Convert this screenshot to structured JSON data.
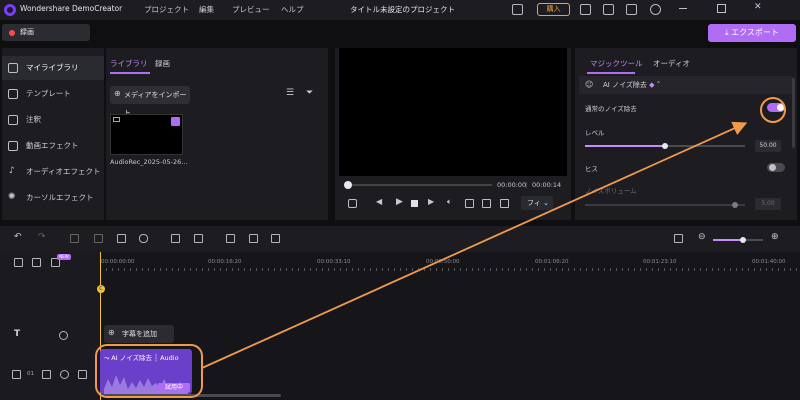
{
  "titlebar": {
    "app_name": "Wondershare DemoCreator",
    "menu": [
      "プロジェクト",
      "編集",
      "プレビュー",
      "ヘルプ"
    ],
    "project_title": "タイトル未設定のプロジェクト",
    "buy_label": "購入"
  },
  "toolbar": {
    "record_label": "録画",
    "export_label": "エクスポート"
  },
  "sidebar": {
    "items": [
      {
        "label": "マイライブラリ",
        "icon": "layers-icon"
      },
      {
        "label": "テンプレート",
        "icon": "template-icon"
      },
      {
        "label": "注釈",
        "icon": "annotation-icon"
      },
      {
        "label": "動画エフェクト",
        "icon": "video-effect-icon"
      },
      {
        "label": "オーディオエフェクト",
        "icon": "music-note-icon"
      },
      {
        "label": "カーソルエフェクト",
        "icon": "cursor-effect-icon"
      }
    ]
  },
  "library": {
    "tabs": [
      "ライブラリ",
      "録画"
    ],
    "import_label": "メディアをインポート",
    "media_name": "AudioRec_2025-05-26..."
  },
  "preview": {
    "current_time": "00:00:00",
    "total_time": "00:00:14",
    "fit_label": "フィ"
  },
  "right_panel": {
    "tabs": [
      "マジックツール",
      "オーディオ"
    ],
    "section_title": "AI ノイズ除去",
    "normal_noise_label": "通常のノイズ除去",
    "normal_noise_on": true,
    "level_label": "レベル",
    "level_value": "50.00",
    "level_fraction": 0.5,
    "hiss_label": "ヒス",
    "hiss_on": false,
    "noise_volume_label": "ノイズボリューム",
    "noise_volume_value": "5.00",
    "accent": "#b06cf5"
  },
  "timeline": {
    "ruler": [
      "00:00:00:00",
      "00:00:16:20",
      "00:00:33:10",
      "00:00:50:00",
      "00:01:06:20",
      "00:01:23:10",
      "00:01:40:00"
    ],
    "badge_new": "NEW",
    "add_subtitle_label": "字幕を追加",
    "track_number": "01",
    "clip_label": "AI ノイズ除去",
    "clip_sublabel": "Audio",
    "trial_label": "試用中"
  }
}
